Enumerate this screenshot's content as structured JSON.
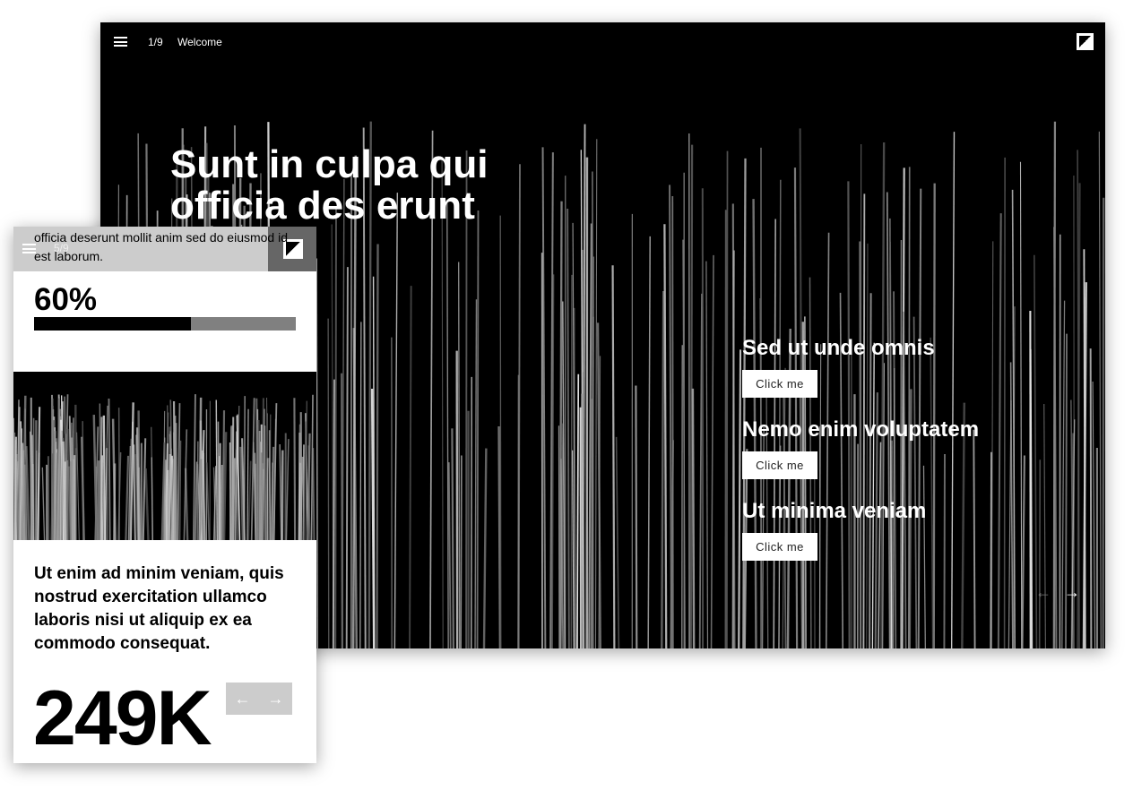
{
  "desktop": {
    "page": "1/9",
    "title": "Welcome",
    "hero": [
      "Sunt in culpa qui",
      "officia des erunt"
    ],
    "sections": [
      {
        "heading": "Sed ut unde omnis",
        "button": "Click me"
      },
      {
        "heading": "Nemo enim voluptatem",
        "button": "Click me"
      },
      {
        "heading": "Ut minima veniam",
        "button": "Click me"
      }
    ],
    "prev_icon": "←",
    "next_icon": "→"
  },
  "mobile": {
    "page": "5/9",
    "overlay_text": "officia deserunt mollit anim sed do eiusmod id est laborum.",
    "progress_label": "60%",
    "progress": 0.6,
    "paragraph": "Ut enim ad minim veniam, quis nostrud exercitation ullamco laboris nisi ut aliquip ex ea commodo consequat.",
    "stat": "249K",
    "prev_icon": "←",
    "next_icon": "→"
  }
}
